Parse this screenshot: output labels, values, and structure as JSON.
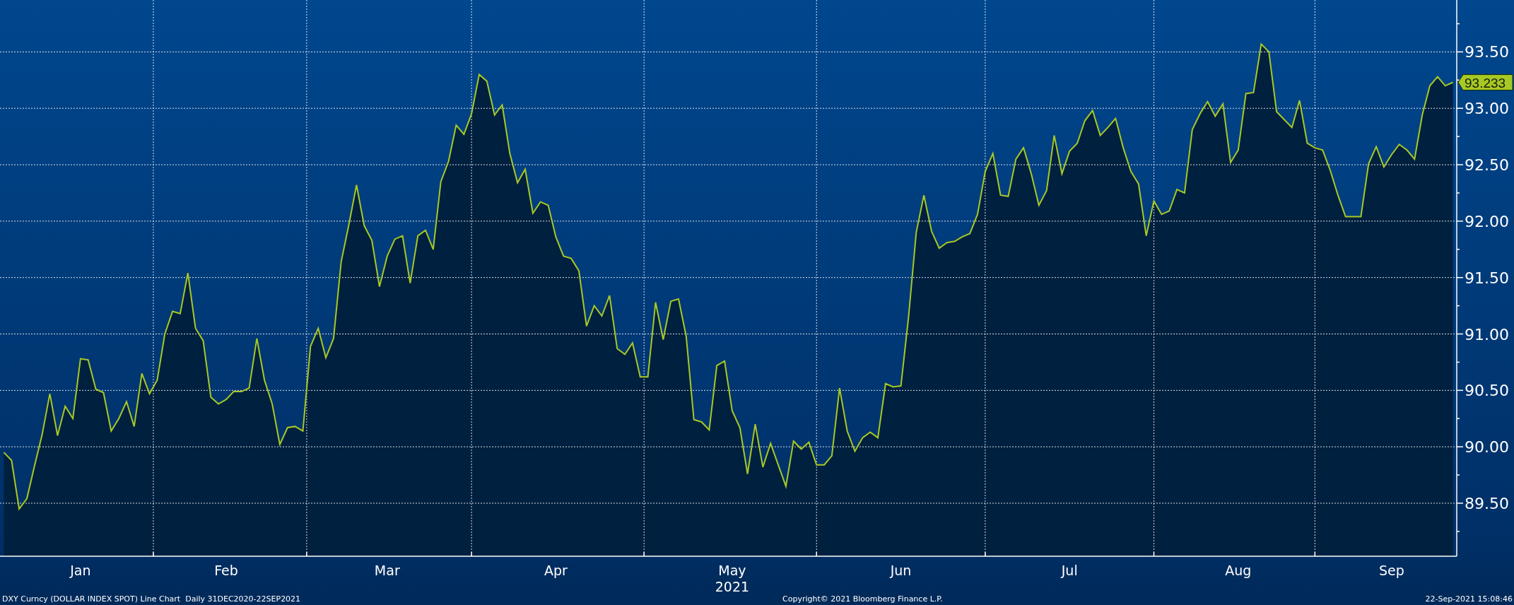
{
  "chart": {
    "shaded_below_line": true,
    "chart_data": {
      "type": "line",
      "grid": true,
      "xlabel": "2021",
      "categories": [
        null,
        null,
        null,
        null,
        null,
        null,
        null,
        null,
        null,
        null,
        "Jan",
        null,
        null,
        null,
        null,
        null,
        null,
        null,
        null,
        null,
        null,
        null,
        null,
        null,
        null,
        null,
        null,
        null,
        null,
        "Feb",
        null,
        null,
        null,
        null,
        null,
        null,
        null,
        null,
        null,
        null,
        null,
        null,
        null,
        null,
        null,
        null,
        null,
        null,
        null,
        null,
        "Mar",
        null,
        null,
        null,
        null,
        null,
        null,
        null,
        null,
        null,
        null,
        null,
        null,
        null,
        null,
        null,
        null,
        null,
        null,
        null,
        null,
        null,
        "Apr",
        null,
        null,
        null,
        null,
        null,
        null,
        null,
        null,
        null,
        null,
        null,
        null,
        null,
        null,
        null,
        null,
        null,
        null,
        null,
        null,
        null,
        null,
        "May",
        null,
        null,
        null,
        null,
        null,
        null,
        null,
        null,
        null,
        null,
        null,
        null,
        null,
        null,
        null,
        null,
        null,
        null,
        null,
        null,
        null,
        "Jun",
        null,
        null,
        null,
        null,
        null,
        null,
        null,
        null,
        null,
        null,
        null,
        null,
        null,
        null,
        null,
        null,
        null,
        null,
        null,
        null,
        null,
        "Jul",
        null,
        null,
        null,
        null,
        null,
        null,
        null,
        null,
        null,
        null,
        null,
        null,
        null,
        null,
        null,
        null,
        null,
        null,
        null,
        null,
        null,
        "Aug",
        null,
        null,
        null,
        null,
        null,
        null,
        null,
        null,
        null,
        null,
        null,
        null,
        null,
        null,
        null,
        null,
        null,
        null,
        null,
        "Sep",
        null,
        null,
        null,
        null,
        null,
        null,
        null,
        null
      ],
      "ylim": [
        89.03,
        93.96
      ],
      "yticks": [
        {
          "value": 89.5,
          "label": "89.50"
        },
        {
          "value": 90,
          "label": "90.00"
        },
        {
          "value": 90.5,
          "label": "90.50"
        },
        {
          "value": 91,
          "label": "91.00"
        },
        {
          "value": 91.5,
          "label": "91.50"
        },
        {
          "value": 92,
          "label": "92.00"
        },
        {
          "value": 92.5,
          "label": "92.50"
        },
        {
          "value": 93,
          "label": "93.00"
        },
        {
          "value": 93.5,
          "label": "93.50"
        }
      ],
      "series": [
        {
          "color": "#a8c824",
          "values": [
            89.95,
            89.88,
            89.45,
            89.54,
            89.83,
            90.11,
            90.47,
            90.1,
            90.36,
            90.25,
            90.78,
            90.77,
            90.51,
            90.48,
            90.14,
            90.25,
            90.4,
            90.18,
            90.65,
            90.47,
            90.59,
            91.0,
            91.2,
            91.18,
            91.54,
            91.05,
            90.94,
            90.44,
            90.38,
            90.42,
            90.49,
            90.49,
            90.52,
            90.96,
            90.59,
            90.38,
            90.02,
            90.17,
            90.18,
            90.14,
            90.89,
            91.05,
            90.79,
            90.96,
            91.64,
            91.97,
            92.32,
            91.96,
            91.83,
            91.42,
            91.69,
            91.84,
            91.87,
            91.45,
            91.87,
            91.92,
            91.75,
            92.35,
            92.53,
            92.85,
            92.77,
            92.95,
            93.3,
            93.24,
            92.94,
            93.03,
            92.6,
            92.34,
            92.46,
            92.07,
            92.17,
            92.14,
            91.86,
            91.69,
            91.67,
            91.56,
            91.07,
            91.25,
            91.16,
            91.34,
            90.87,
            90.82,
            90.92,
            90.62,
            90.62,
            91.28,
            90.95,
            91.29,
            91.31,
            90.98,
            90.24,
            90.22,
            90.15,
            90.72,
            90.76,
            90.32,
            90.17,
            89.76,
            90.2,
            89.82,
            90.03,
            89.84,
            89.65,
            90.05,
            89.98,
            90.04,
            89.84,
            89.84,
            89.92,
            90.52,
            90.14,
            89.96,
            90.08,
            90.13,
            90.08,
            90.56,
            90.53,
            90.54,
            91.15,
            91.9,
            92.23,
            91.91,
            91.76,
            91.81,
            91.82,
            91.86,
            91.89,
            92.06,
            92.44,
            92.6,
            92.23,
            92.22,
            92.55,
            92.65,
            92.42,
            92.14,
            92.27,
            92.76,
            92.42,
            92.62,
            92.69,
            92.89,
            92.98,
            92.76,
            92.83,
            92.91,
            92.65,
            92.44,
            92.33,
            91.87,
            92.18,
            92.06,
            92.09,
            92.28,
            92.25,
            92.81,
            92.95,
            93.06,
            92.93,
            93.04,
            92.52,
            92.63,
            93.13,
            93.14,
            93.57,
            93.5,
            92.97,
            92.9,
            92.83,
            93.07,
            92.69,
            92.65,
            92.63,
            92.45,
            92.23,
            92.04,
            92.04,
            92.04,
            92.51,
            92.66,
            92.48,
            92.59,
            92.68,
            92.63,
            92.55,
            92.94,
            93.2,
            93.28,
            93.2,
            93.23
          ]
        }
      ]
    },
    "last_price_tag": "93.233"
  },
  "footer": {
    "description": "DXY Curncy (DOLLAR INDEX SPOT) Line Chart  Daily 31DEC2020-22SEP2021",
    "copyright": "Copyright© 2021 Bloomberg Finance L.P.",
    "timestamp": "22-Sep-2021 15:08:46"
  }
}
